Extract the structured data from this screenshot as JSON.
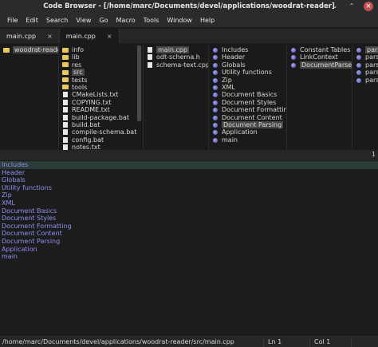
{
  "window": {
    "title": "Code Browser - [/home/marc/Documents/devel/applications/woodrat-reader]",
    "minimize_glyph": "⌄",
    "maximize_glyph": "⌃",
    "close_glyph": "×"
  },
  "menu": [
    "File",
    "Edit",
    "Search",
    "View",
    "Go",
    "Macro",
    "Tools",
    "Window",
    "Help"
  ],
  "tabs": [
    {
      "label": "main.cpp",
      "close": "×",
      "active": false
    },
    {
      "label": "main.cpp",
      "close": "×",
      "active": true
    }
  ],
  "browser": {
    "col1": [
      {
        "label": "woodrat-reader",
        "icon": "folder-icon",
        "selected": true
      }
    ],
    "col2": [
      {
        "label": "info",
        "icon": "folder-icon"
      },
      {
        "label": "lib",
        "icon": "folder-icon"
      },
      {
        "label": "res",
        "icon": "folder-icon"
      },
      {
        "label": "src",
        "icon": "folder-icon",
        "selected": true
      },
      {
        "label": "tests",
        "icon": "folder-icon"
      },
      {
        "label": "tools",
        "icon": "folder-icon"
      },
      {
        "label": "CMakeLists.txt",
        "icon": "file-icon"
      },
      {
        "label": "COPYING.txt",
        "icon": "file-icon"
      },
      {
        "label": "README.txt",
        "icon": "file-icon"
      },
      {
        "label": "build-package.bat",
        "icon": "file-icon"
      },
      {
        "label": "build.bat",
        "icon": "file-icon"
      },
      {
        "label": "compile-schema.bat",
        "icon": "file-icon"
      },
      {
        "label": "config.bat",
        "icon": "file-icon"
      },
      {
        "label": "notes.txt",
        "icon": "file-icon"
      }
    ],
    "col3": [
      {
        "label": "main.cpp",
        "icon": "file-icon",
        "selected": true
      },
      {
        "label": "odt-schema.h",
        "icon": "file-icon"
      },
      {
        "label": "schema-text.cpp",
        "icon": "file-icon"
      }
    ],
    "col4": [
      {
        "label": "Includes",
        "icon": "bullet-icon"
      },
      {
        "label": "Header",
        "icon": "bullet-icon"
      },
      {
        "label": "Globals",
        "icon": "bullet-icon"
      },
      {
        "label": "Utility functions",
        "icon": "bullet-icon"
      },
      {
        "label": "Zip",
        "icon": "bullet-icon"
      },
      {
        "label": "XML",
        "icon": "bullet-icon"
      },
      {
        "label": "Document Basics",
        "icon": "bullet-icon"
      },
      {
        "label": "Document Styles",
        "icon": "bullet-icon"
      },
      {
        "label": "Document Formatting",
        "icon": "bullet-icon"
      },
      {
        "label": "Document Content",
        "icon": "bullet-icon"
      },
      {
        "label": "Document Parsing",
        "icon": "bullet-icon",
        "selected": true
      },
      {
        "label": "Application",
        "icon": "bullet-icon"
      },
      {
        "label": "main",
        "icon": "bullet-icon"
      }
    ],
    "col5": [
      {
        "label": "Constant Tables",
        "icon": "bullet-icon"
      },
      {
        "label": "LinkContext",
        "icon": "bullet-icon"
      },
      {
        "label": "DocumentParser",
        "icon": "bullet-icon",
        "selected": true
      }
    ],
    "col6": [
      {
        "label": "parse",
        "icon": "bullet-icon",
        "selected": true
      },
      {
        "label": "pars",
        "icon": "bullet-icon"
      },
      {
        "label": "pars",
        "icon": "bullet-icon"
      },
      {
        "label": "pars",
        "icon": "bullet-icon"
      },
      {
        "label": "pars",
        "icon": "bullet-icon"
      }
    ]
  },
  "separator": {
    "number": "1"
  },
  "editor": {
    "lines": [
      "Includes",
      "Header",
      "Globals",
      "Utility functions",
      "Zip",
      "XML",
      "Document Basics",
      "Document Styles",
      "Document Formatting",
      "Document Content",
      "Document Parsing",
      "Application",
      "main"
    ],
    "current_line": 0
  },
  "status": {
    "path": "/home/marc/Documents/devel/applications/woodrat-reader/src/main.cpp",
    "line": "Ln 1",
    "col": "Col 1"
  },
  "colors": {
    "background": "#1c1c1c",
    "folder": "#e9c75a",
    "bullet": "#6a6ad8",
    "editor_text": "#8f8ff5",
    "current_line": "#2a3b38",
    "selection": "#474747"
  }
}
